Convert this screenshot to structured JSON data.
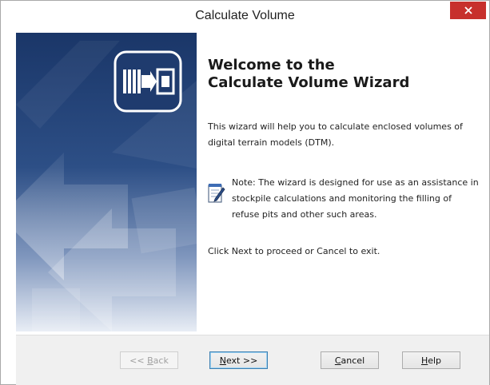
{
  "window": {
    "title": "Calculate Volume",
    "close_glyph": "×"
  },
  "welcome": {
    "heading_line1": "Welcome to the",
    "heading_line2": "Calculate Volume Wizard",
    "intro": "This wizard will help you to calculate enclosed volumes of digital terrain models (DTM).",
    "note": "Note: The wizard is designed for use as an assistance in stockpile calculations and monitoring the filling of refuse pits and other such areas.",
    "instructions": "Click Next to proceed or Cancel to exit."
  },
  "buttons": {
    "back": {
      "label": "<< Back",
      "prefix": "<< ",
      "accel": "B",
      "rest": "ack",
      "enabled": false
    },
    "next": {
      "label": "Next >>",
      "accel": "N",
      "rest": "ext >>",
      "enabled": true
    },
    "cancel": {
      "label": "Cancel",
      "accel": "C",
      "rest": "ancel",
      "enabled": true
    },
    "help": {
      "label": "Help",
      "accel": "H",
      "rest": "elp",
      "enabled": true
    }
  },
  "icons": {
    "banner_logo": "volume-wizard-logo-icon",
    "note": "notepad-pencil-icon",
    "close": "close-icon"
  },
  "colors": {
    "banner_dark": "#1d3a70",
    "banner_light": "#c9d4e6",
    "close_bg": "#c7302c"
  }
}
